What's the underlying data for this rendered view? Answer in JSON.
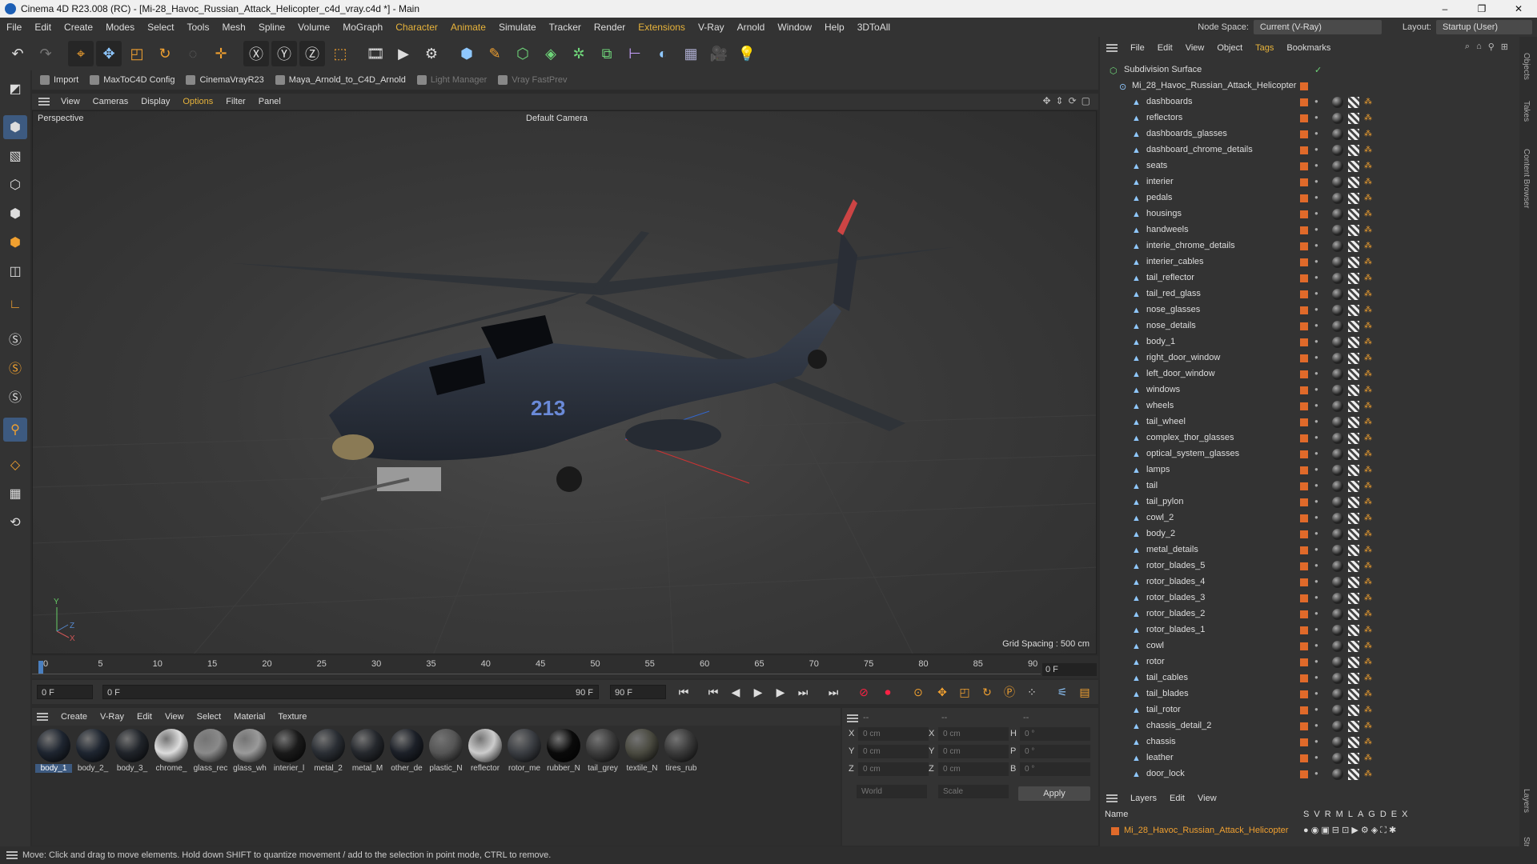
{
  "window": {
    "title": "Cinema 4D R23.008 (RC) - [Mi-28_Havoc_Russian_Attack_Helicopter_c4d_vray.c4d *] - Main",
    "controls": [
      "–",
      "❐",
      "✕"
    ]
  },
  "menubar": {
    "items": [
      "File",
      "Edit",
      "Create",
      "Modes",
      "Select",
      "Tools",
      "Mesh",
      "Spline",
      "Volume",
      "MoGraph",
      "Character",
      "Animate",
      "Simulate",
      "Tracker",
      "Render",
      "Extensions",
      "V-Ray",
      "Arnold",
      "Window",
      "Help",
      "3DToAll"
    ],
    "highlighted": [
      "Character",
      "Animate",
      "Extensions"
    ],
    "node_space_label": "Node Space:",
    "node_space_value": "Current (V-Ray)",
    "layout_label": "Layout:",
    "layout_value": "Startup (User)"
  },
  "plugin_bar": {
    "items": [
      {
        "label": "Import",
        "enabled": true
      },
      {
        "label": "MaxToC4D Config",
        "enabled": true
      },
      {
        "label": "CinemaVrayR23",
        "enabled": true
      },
      {
        "label": "Maya_Arnold_to_C4D_Arnold",
        "enabled": true
      },
      {
        "label": "Light Manager",
        "enabled": false
      },
      {
        "label": "Vray FastPrev",
        "enabled": false
      }
    ]
  },
  "viewport": {
    "menu": [
      "View",
      "Cameras",
      "Display",
      "Options",
      "Filter",
      "Panel"
    ],
    "highlighted": "Options",
    "name": "Perspective",
    "camera": "Default Camera",
    "grid_spacing": "Grid Spacing : 500 cm",
    "axis_labels": {
      "y": "Y",
      "z": "Z",
      "x": "X"
    }
  },
  "timeline": {
    "ticks": [
      "0",
      "5",
      "10",
      "15",
      "20",
      "25",
      "30",
      "35",
      "40",
      "45",
      "50",
      "55",
      "60",
      "65",
      "70",
      "75",
      "80",
      "85",
      "90"
    ],
    "current_frame": "0 F",
    "start_field": "0 F",
    "range_start": "0 F",
    "range_end": "90 F",
    "end_field": "90 F"
  },
  "material_manager": {
    "menu": [
      "Create",
      "V-Ray",
      "Edit",
      "View",
      "Select",
      "Material",
      "Texture"
    ],
    "materials": [
      {
        "name": "body_1",
        "color": "#1e2530",
        "selected": true
      },
      {
        "name": "body_2_",
        "color": "#1e2530"
      },
      {
        "name": "body_3_",
        "color": "#20242a"
      },
      {
        "name": "chrome_",
        "color": "#dddddd"
      },
      {
        "name": "glass_rec",
        "color": "#8a8a8a"
      },
      {
        "name": "glass_wh",
        "color": "#9a9a9a"
      },
      {
        "name": "interier_l",
        "color": "#1a1a1a"
      },
      {
        "name": "metal_2",
        "color": "#2a2e34"
      },
      {
        "name": "metal_M",
        "color": "#25282d"
      },
      {
        "name": "other_de",
        "color": "#1c2028"
      },
      {
        "name": "plastic_N",
        "color": "#555555"
      },
      {
        "name": "reflector",
        "color": "#cccccc"
      },
      {
        "name": "rotor_me",
        "color": "#3a3d42"
      },
      {
        "name": "rubber_N",
        "color": "#0a0a0a"
      },
      {
        "name": "tail_grey",
        "color": "#3c3c3c"
      },
      {
        "name": "textile_N",
        "color": "#4a4a40"
      },
      {
        "name": "tires_rub",
        "color": "#3a3a3a"
      }
    ]
  },
  "coordinates": {
    "header": [
      "--",
      "--",
      "--"
    ],
    "rows": [
      {
        "a": "X",
        "av": "0 cm",
        "b": "X",
        "bv": "0 cm",
        "c": "H",
        "cv": "0 °"
      },
      {
        "a": "Y",
        "av": "0 cm",
        "b": "Y",
        "bv": "0 cm",
        "c": "P",
        "cv": "0 °"
      },
      {
        "a": "Z",
        "av": "0 cm",
        "b": "Z",
        "bv": "0 cm",
        "c": "B",
        "cv": "0 °"
      }
    ],
    "mode": "World",
    "transform": "Scale",
    "apply": "Apply"
  },
  "status": "Move: Click and drag to move elements. Hold down SHIFT to quantize movement / add to the selection in point mode, CTRL to remove.",
  "object_manager": {
    "menu": [
      "File",
      "Edit",
      "View",
      "Object",
      "Tags",
      "Bookmarks"
    ],
    "highlighted": "Tags",
    "root": "Subdivision Surface",
    "group": "Mi_28_Havoc_Russian_Attack_Helicopter",
    "objects": [
      "dashboards",
      "reflectors",
      "dashboards_glasses",
      "dashboard_chrome_details",
      "seats",
      "interier",
      "pedals",
      "housings",
      "handweels",
      "interie_chrome_details",
      "interier_cables",
      "tail_reflector",
      "tail_red_glass",
      "nose_glasses",
      "nose_details",
      "body_1",
      "right_door_window",
      "left_door_window",
      "windows",
      "wheels",
      "tail_wheel",
      "complex_thor_glasses",
      "optical_system_glasses",
      "lamps",
      "tail",
      "tail_pylon",
      "cowl_2",
      "body_2",
      "metal_details",
      "rotor_blades_5",
      "rotor_blades_4",
      "rotor_blades_3",
      "rotor_blades_2",
      "rotor_blades_1",
      "cowl",
      "rotor",
      "tail_cables",
      "tail_blades",
      "tail_rotor",
      "chassis_detail_2",
      "chassis",
      "leather",
      "door_lock"
    ],
    "layer_color": "#e06a2a"
  },
  "side_tabs": [
    "Objects",
    "Takes",
    "Content Browser",
    "Layers",
    "Str"
  ],
  "layers": {
    "menu": [
      "Layers",
      "Edit",
      "View"
    ],
    "columns_label": "Name",
    "columns": [
      "S",
      "V",
      "R",
      "M",
      "L",
      "A",
      "G",
      "D",
      "E",
      "X"
    ],
    "row": "Mi_28_Havoc_Russian_Attack_Helicopter"
  }
}
